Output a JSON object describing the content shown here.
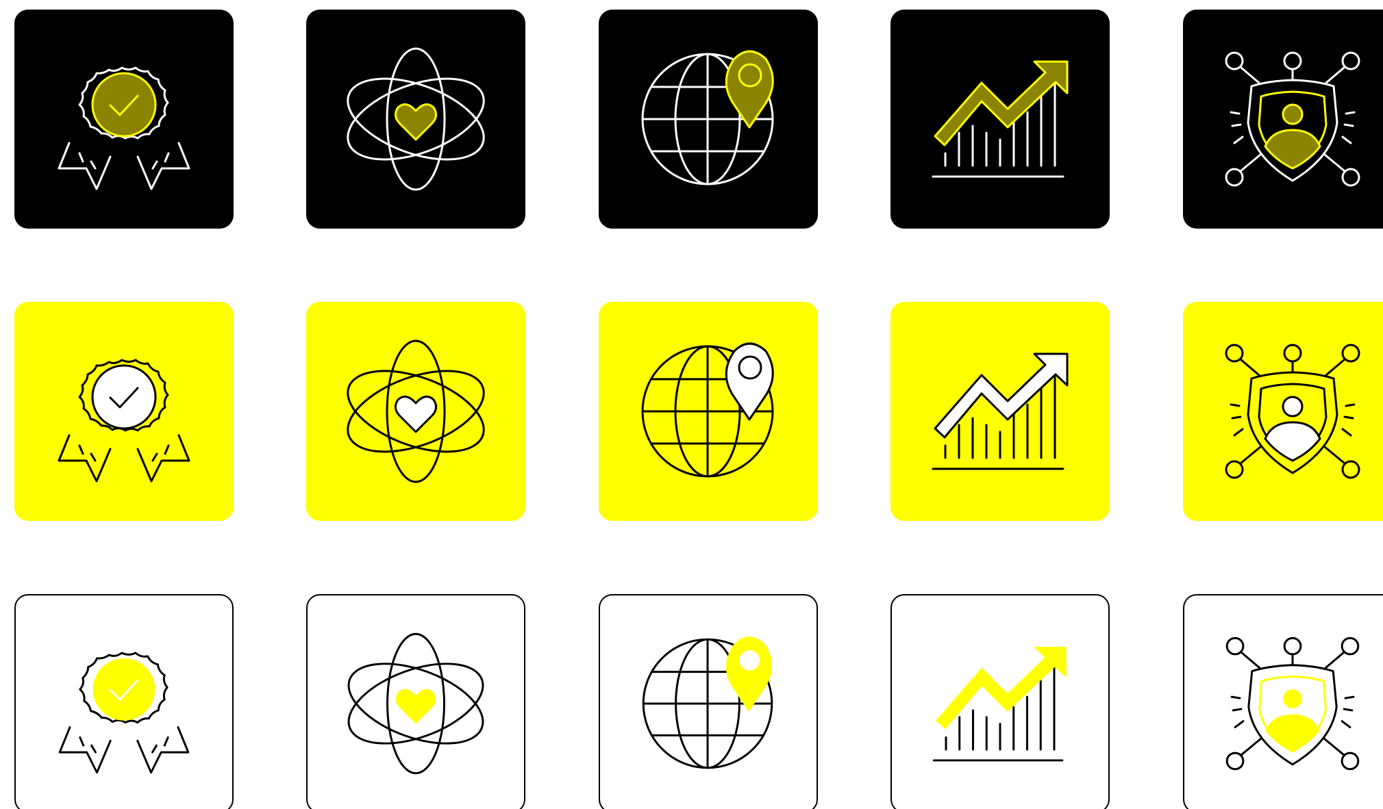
{
  "palette": {
    "black": "#000000",
    "yellow": "#FFFF00",
    "olive": "#8A8400",
    "white": "#FFFFFF"
  },
  "rows": [
    {
      "style": "dark",
      "background": "#000000",
      "line": "#FFFFFF",
      "accent_fill": "#8A8400",
      "accent_stroke": "#FFFF00"
    },
    {
      "style": "yellow",
      "background": "#FFFF00",
      "line": "#000000",
      "accent_fill": "#FFFFFF",
      "accent_stroke": "#000000"
    },
    {
      "style": "outline",
      "background": "#FFFFFF",
      "line": "#000000",
      "accent_fill": "#FFFF00",
      "accent_stroke": "#FFFF00"
    }
  ],
  "icons": [
    "award-badge-icon",
    "atom-heart-icon",
    "globe-location-pin-icon",
    "growth-chart-icon",
    "security-shield-network-icon"
  ]
}
